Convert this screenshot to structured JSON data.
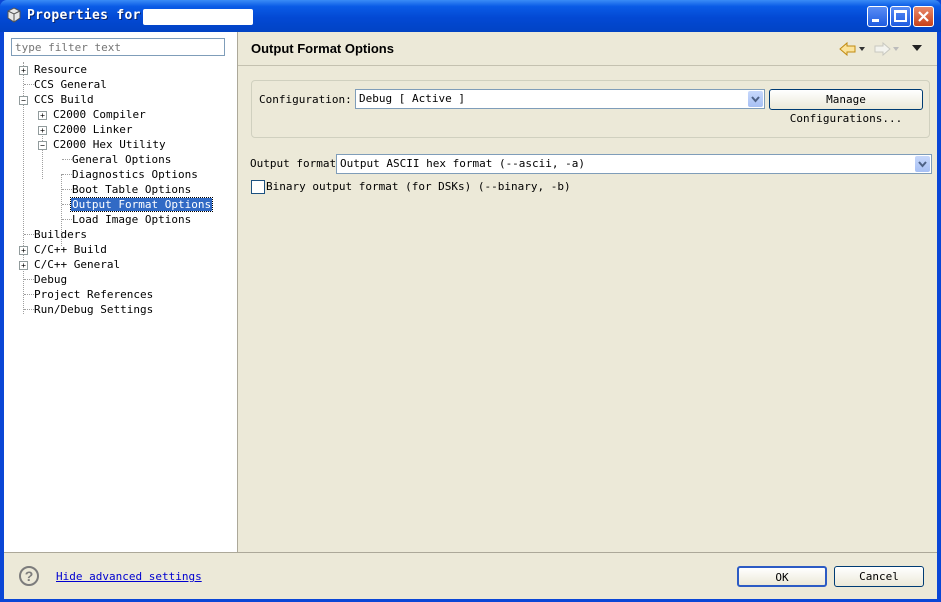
{
  "window": {
    "title": "Properties for"
  },
  "filter": {
    "placeholder": "type filter text"
  },
  "tree": {
    "items": [
      {
        "label": "Resource"
      },
      {
        "label": "CCS General"
      },
      {
        "label": "CCS Build"
      },
      {
        "label": "C2000 Compiler"
      },
      {
        "label": "C2000 Linker"
      },
      {
        "label": "C2000 Hex Utility"
      },
      {
        "label": "General Options"
      },
      {
        "label": "Diagnostics Options"
      },
      {
        "label": "Boot Table Options"
      },
      {
        "label": "Output Format Options"
      },
      {
        "label": "Load Image Options"
      },
      {
        "label": "Builders"
      },
      {
        "label": "C/C++ Build"
      },
      {
        "label": "C/C++ General"
      },
      {
        "label": "Debug"
      },
      {
        "label": "Project References"
      },
      {
        "label": "Run/Debug Settings"
      }
    ]
  },
  "page": {
    "title": "Output Format Options"
  },
  "configuration": {
    "label": "Configuration:",
    "value": "Debug  [ Active ]",
    "manage_button": "Manage Configurations..."
  },
  "output_format": {
    "label": "Output format",
    "value": "Output ASCII hex format (--ascii, -a)"
  },
  "binary_option": {
    "label": "Binary output format (for DSKs) (--binary, -b)"
  },
  "footer": {
    "advanced_link": "Hide advanced settings",
    "ok": "OK",
    "cancel": "Cancel"
  }
}
